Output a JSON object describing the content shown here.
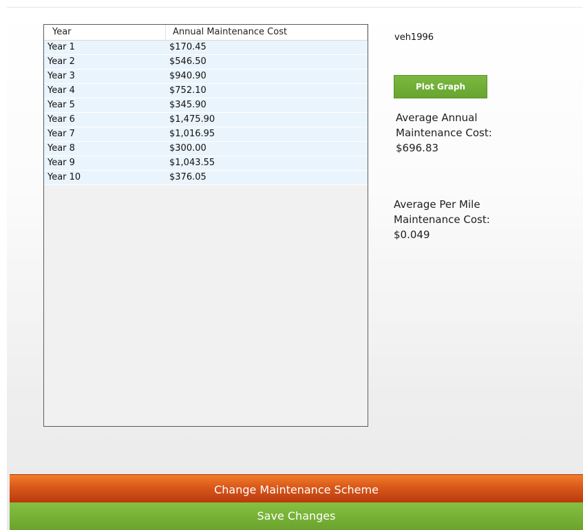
{
  "vehicle": {
    "id": "veh1996"
  },
  "table": {
    "columns": [
      "Year",
      "Annual Maintenance Cost"
    ],
    "rows": [
      {
        "year": "Year 1",
        "cost": "$170.45"
      },
      {
        "year": "Year 2",
        "cost": "$546.50"
      },
      {
        "year": "Year 3",
        "cost": "$940.90"
      },
      {
        "year": "Year 4",
        "cost": "$752.10"
      },
      {
        "year": "Year 5",
        "cost": "$345.90"
      },
      {
        "year": "Year 6",
        "cost": "$1,475.90"
      },
      {
        "year": "Year 7",
        "cost": "$1,016.95"
      },
      {
        "year": "Year 8",
        "cost": "$300.00"
      },
      {
        "year": "Year 9",
        "cost": "$1,043.55"
      },
      {
        "year": "Year 10",
        "cost": "$376.05"
      }
    ]
  },
  "buttons": {
    "plot_graph": "Plot Graph",
    "change_scheme": "Change Maintenance Scheme",
    "save_changes": "Save Changes"
  },
  "stats": {
    "annual_label_1": "Average Annual",
    "annual_label_2": "Maintenance Cost:",
    "annual_value": "$696.83",
    "per_mile_label_1": "Average Per Mile",
    "per_mile_label_2": "Maintenance Cost:",
    "per_mile_value": "$0.049"
  },
  "colors": {
    "plot_button": "#6fae36",
    "change_bar": "#d0541a",
    "save_bar": "#79b33a",
    "row_highlight": "#eaf4fc"
  }
}
